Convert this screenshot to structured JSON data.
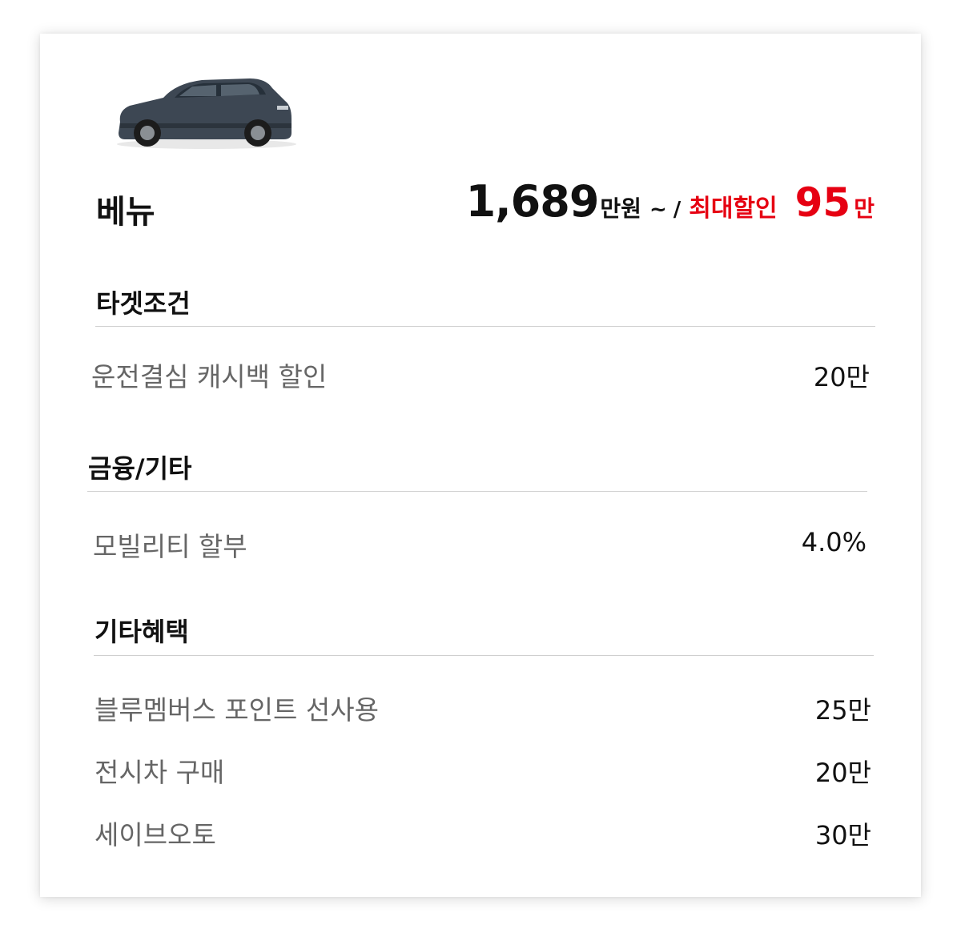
{
  "model": {
    "name": "베뉴",
    "price": "1,689",
    "price_unit": "만원",
    "tilde": "~",
    "separator": "/",
    "discount_label": "최대할인",
    "discount_amount": "95",
    "discount_unit": "만",
    "car_color": "#3d4753"
  },
  "sections": [
    {
      "title": "타겟조건",
      "items": [
        {
          "label": "운전결심 캐시백 할인",
          "value": "20만"
        }
      ]
    },
    {
      "title": "금융/기타",
      "items": [
        {
          "label": "모빌리티 할부",
          "value": "4.0%"
        }
      ]
    },
    {
      "title": "기타혜택",
      "items": [
        {
          "label": "블루멤버스 포인트 선사용",
          "value": "25만"
        },
        {
          "label": "전시차 구매",
          "value": "20만"
        },
        {
          "label": "세이브오토",
          "value": "30만"
        }
      ]
    }
  ],
  "colors": {
    "accent_red": "#e60012",
    "label_gray": "#666666",
    "text_dark": "#111111"
  }
}
